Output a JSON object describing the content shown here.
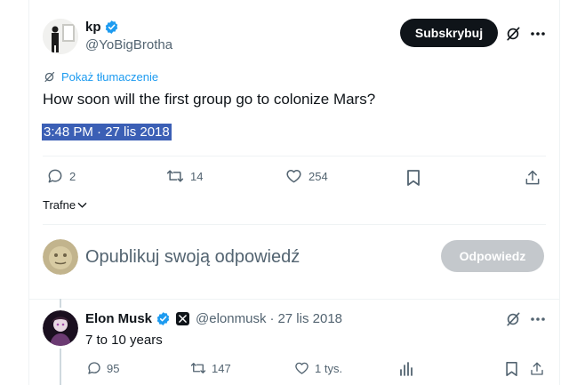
{
  "tweet": {
    "author_name": "kp",
    "author_handle": "@YoBigBrotha",
    "subscribe_label": "Subskrybuj",
    "translate_label": "Pokaż tłumaczenie",
    "text": "How soon will the first group go to colonize Mars?",
    "timestamp": "3:48 PM · 27 lis 2018",
    "stats": {
      "replies": "2",
      "retweets": "14",
      "likes": "254"
    }
  },
  "sort": {
    "label": "Trafne"
  },
  "compose": {
    "placeholder": "Opublikuj swoją odpowiedź",
    "reply_button": "Odpowiedz"
  },
  "reply": {
    "author_name": "Elon Musk",
    "author_handle": "@elonmusk",
    "date": "27 lis 2018",
    "text": "7 to 10 years",
    "stats": {
      "replies": "95",
      "retweets": "147",
      "likes": "1 tys."
    }
  },
  "colors": {
    "accent": "#1d9bf0",
    "text": "#0f1419",
    "muted": "#536471",
    "button_dark": "#0f1419",
    "button_disabled": "#c4c8cc",
    "selection": "#3b5fb5"
  }
}
